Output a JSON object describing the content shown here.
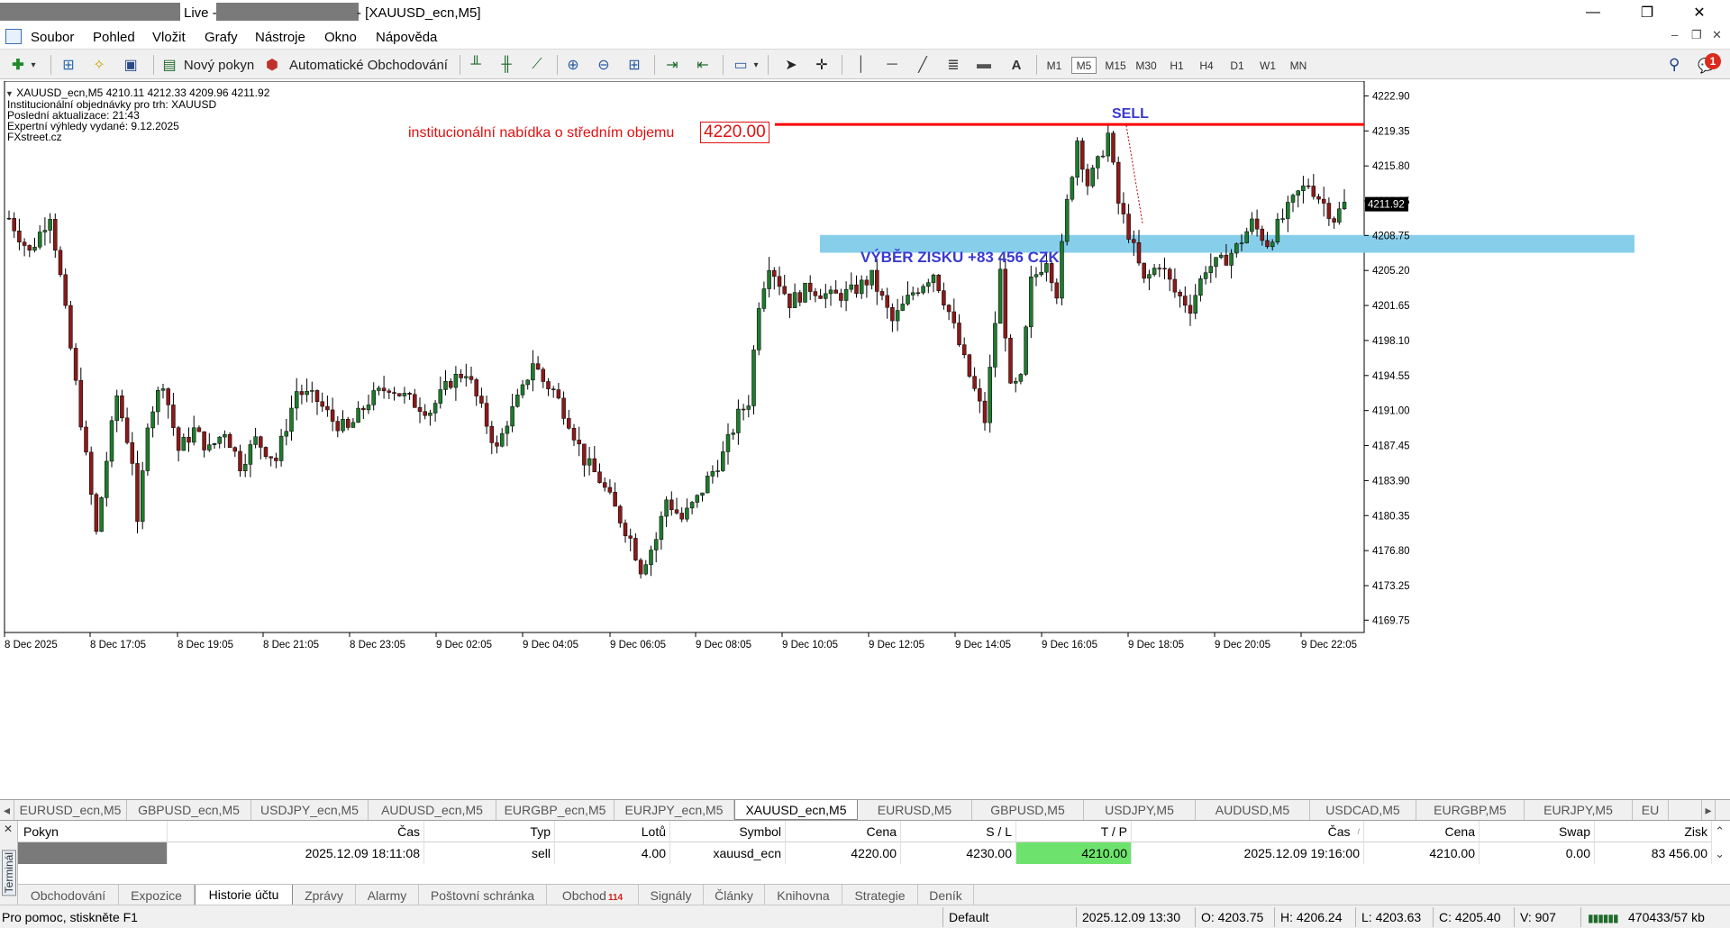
{
  "window": {
    "title_prefix": "Live -",
    "title_suffix": "- [XAUUSD_ecn,M5]",
    "controls": {
      "minimize": "—",
      "maximize": "❐",
      "close": "✕"
    }
  },
  "menu": {
    "items": [
      "Soubor",
      "Pohled",
      "Vložit",
      "Grafy",
      "Nástroje",
      "Okno",
      "Nápověda"
    ],
    "mdi_controls": {
      "minimize": "–",
      "restore": "❐",
      "close": "✕"
    }
  },
  "toolbar": {
    "new_order_label": "Nový pokyn",
    "auto_trading_label": "Automatické Obchodování",
    "draw_text_label": "A",
    "timeframes": [
      "M1",
      "M5",
      "M15",
      "M30",
      "H1",
      "H4",
      "D1",
      "W1",
      "MN"
    ],
    "active_timeframe": "M5",
    "notification_count": "1"
  },
  "chart": {
    "header_line": "XAUUSD_ecn,M5  4210.11 4212.33 4209.96 4211.92",
    "info_lines": [
      "Institucionální objednávky pro trh: XAUUSD",
      "Poslední aktualizace: 21:43",
      "Expertní výhledy vydané: 9.12.2025",
      "FXstreet.cz"
    ],
    "annotations": {
      "offer_label": "institucionální nabídka o středním objemu",
      "offer_price": "4220.00",
      "sell_label": "SELL",
      "profit_label": "VÝBĚR ZISKU +83 456 CZK"
    },
    "colors": {
      "up": "#1f7a2e",
      "down": "#8a1a1a",
      "offer_line": "#ff0000",
      "zone": "#87ceeb",
      "annotation_blue": "#3a3ad0"
    }
  },
  "chart_data": {
    "type": "candlestick",
    "symbol": "XAUUSD_ecn",
    "timeframe": "M5",
    "ylim": [
      4168.5,
      4224.4
    ],
    "y_ticks": [
      "4222.90",
      "4219.35",
      "4215.80",
      "4212.25",
      "4208.75",
      "4205.20",
      "4201.65",
      "4198.10",
      "4194.55",
      "4191.00",
      "4187.45",
      "4183.90",
      "4180.35",
      "4176.80",
      "4173.25",
      "4169.75"
    ],
    "current_price": "4211.92",
    "x_ticks": [
      "8 Dec 2025",
      "8 Dec 17:05",
      "8 Dec 19:05",
      "8 Dec 21:05",
      "8 Dec 23:05",
      "9 Dec 02:05",
      "9 Dec 04:05",
      "9 Dec 06:05",
      "9 Dec 08:05",
      "9 Dec 10:05",
      "9 Dec 12:05",
      "9 Dec 14:05",
      "9 Dec 16:05",
      "9 Dec 18:05",
      "9 Dec 20:05",
      "9 Dec 22:05"
    ],
    "offer_level": 4220.0,
    "profit_zone": [
      4207.0,
      4208.8
    ],
    "price_path": [
      [
        0,
        4210.5
      ],
      [
        4,
        4207.0
      ],
      [
        8,
        4211.0
      ],
      [
        10,
        4204.5
      ],
      [
        14,
        4190.0
      ],
      [
        17,
        4178.5
      ],
      [
        19,
        4186.0
      ],
      [
        21,
        4192.5
      ],
      [
        24,
        4186.0
      ],
      [
        25,
        4179.0
      ],
      [
        27,
        4190.0
      ],
      [
        30,
        4194.0
      ],
      [
        33,
        4187.0
      ],
      [
        36,
        4189.0
      ],
      [
        39,
        4187.0
      ],
      [
        42,
        4189.0
      ],
      [
        45,
        4185.5
      ],
      [
        48,
        4188.0
      ],
      [
        52,
        4186.0
      ],
      [
        56,
        4193.0
      ],
      [
        60,
        4192.0
      ],
      [
        63,
        4190.0
      ],
      [
        66,
        4189.0
      ],
      [
        70,
        4192.0
      ],
      [
        74,
        4193.5
      ],
      [
        78,
        4192.0
      ],
      [
        82,
        4191.0
      ],
      [
        86,
        4194.0
      ],
      [
        89,
        4195.0
      ],
      [
        92,
        4191.0
      ],
      [
        95,
        4187.0
      ],
      [
        97,
        4190.0
      ],
      [
        100,
        4193.0
      ],
      [
        102,
        4196.0
      ],
      [
        104,
        4194.0
      ],
      [
        106,
        4193.0
      ],
      [
        109,
        4190.0
      ],
      [
        112,
        4186.0
      ],
      [
        115,
        4184.0
      ],
      [
        118,
        4181.0
      ],
      [
        121,
        4178.0
      ],
      [
        123,
        4175.0
      ],
      [
        126,
        4178.0
      ],
      [
        128,
        4182.0
      ],
      [
        131,
        4180.0
      ],
      [
        134,
        4182.0
      ],
      [
        136,
        4184.0
      ],
      [
        139,
        4186.5
      ],
      [
        142,
        4190.5
      ],
      [
        144,
        4192.0
      ],
      [
        146,
        4202.0
      ],
      [
        148,
        4206.0
      ],
      [
        150,
        4204.0
      ],
      [
        152,
        4202.0
      ],
      [
        156,
        4203.5
      ],
      [
        160,
        4202.5
      ],
      [
        164,
        4203.0
      ],
      [
        168,
        4204.5
      ],
      [
        172,
        4200.0
      ],
      [
        176,
        4203.0
      ],
      [
        180,
        4205.0
      ],
      [
        183,
        4201.0
      ],
      [
        186,
        4196.0
      ],
      [
        188,
        4193.0
      ],
      [
        190,
        4190.0
      ],
      [
        193,
        4205.0
      ],
      [
        195,
        4193.0
      ],
      [
        197,
        4194.0
      ],
      [
        199,
        4204.0
      ],
      [
        202,
        4206.5
      ],
      [
        204,
        4203.0
      ],
      [
        206,
        4212.0
      ],
      [
        208,
        4218.5
      ],
      [
        210,
        4214.0
      ],
      [
        212,
        4216.0
      ],
      [
        214,
        4219.0
      ],
      [
        216,
        4212.0
      ],
      [
        218,
        4209.0
      ],
      [
        221,
        4204.0
      ],
      [
        224,
        4206.0
      ],
      [
        227,
        4203.0
      ],
      [
        230,
        4201.5
      ],
      [
        233,
        4205.5
      ],
      [
        236,
        4206.0
      ],
      [
        239,
        4207.5
      ],
      [
        242,
        4210.0
      ],
      [
        245,
        4208.0
      ],
      [
        248,
        4210.5
      ],
      [
        251,
        4213.0
      ],
      [
        253,
        4214.0
      ],
      [
        256,
        4212.0
      ],
      [
        258,
        4210.5
      ],
      [
        260,
        4211.9
      ]
    ]
  },
  "chart_tabs": {
    "items": [
      "EURUSD_ecn,M5",
      "GBPUSD_ecn,M5",
      "USDJPY_ecn,M5",
      "AUDUSD_ecn,M5",
      "EURGBP_ecn,M5",
      "EURJPY_ecn,M5",
      "XAUUSD_ecn,M5",
      "EURUSD,M5",
      "GBPUSD,M5",
      "USDJPY,M5",
      "AUDUSD,M5",
      "USDCAD,M5",
      "EURGBP,M5",
      "EURJPY,M5",
      "EU"
    ],
    "active": "XAUUSD_ecn,M5",
    "nav_left": "◂",
    "nav_right": "▸"
  },
  "terminal": {
    "side_label": "Terminál",
    "close_icon": "✕",
    "columns": [
      "Pokyn",
      "Čas",
      "Typ",
      "Lotů",
      "Symbol",
      "Cena",
      "S / L",
      "T / P",
      "Čas",
      "Cena",
      "Swap",
      "Zisk"
    ],
    "sort_marker": "/",
    "row": {
      "pokyn": "",
      "open_time": "2025.12.09 18:11:08",
      "type": "sell",
      "lots": "4.00",
      "symbol": "xauusd_ecn",
      "open_price": "4220.00",
      "sl": "4230.00",
      "tp": "4210.00",
      "close_time": "2025.12.09 19:16:00",
      "close_price": "4210.00",
      "swap": "0.00",
      "profit": "83 456.00"
    },
    "tabs": [
      "Obchodování",
      "Expozice",
      "Historie účtu",
      "Zprávy",
      "Alarmy",
      "Poštovní schránka",
      "Obchod",
      "Signály",
      "Články",
      "Knihovna",
      "Strategie",
      "Deník"
    ],
    "active_tab": "Historie účtu",
    "obchod_badge": "114"
  },
  "status": {
    "help": "Pro pomoc, stiskněte F1",
    "profile": "Default",
    "datetime": "2025.12.09 13:30",
    "open": "O: 4203.75",
    "high": "H: 4206.24",
    "low": "L: 4203.63",
    "close": "C: 4205.40",
    "volume": "V: 907",
    "traffic": "470433/57 kb"
  }
}
